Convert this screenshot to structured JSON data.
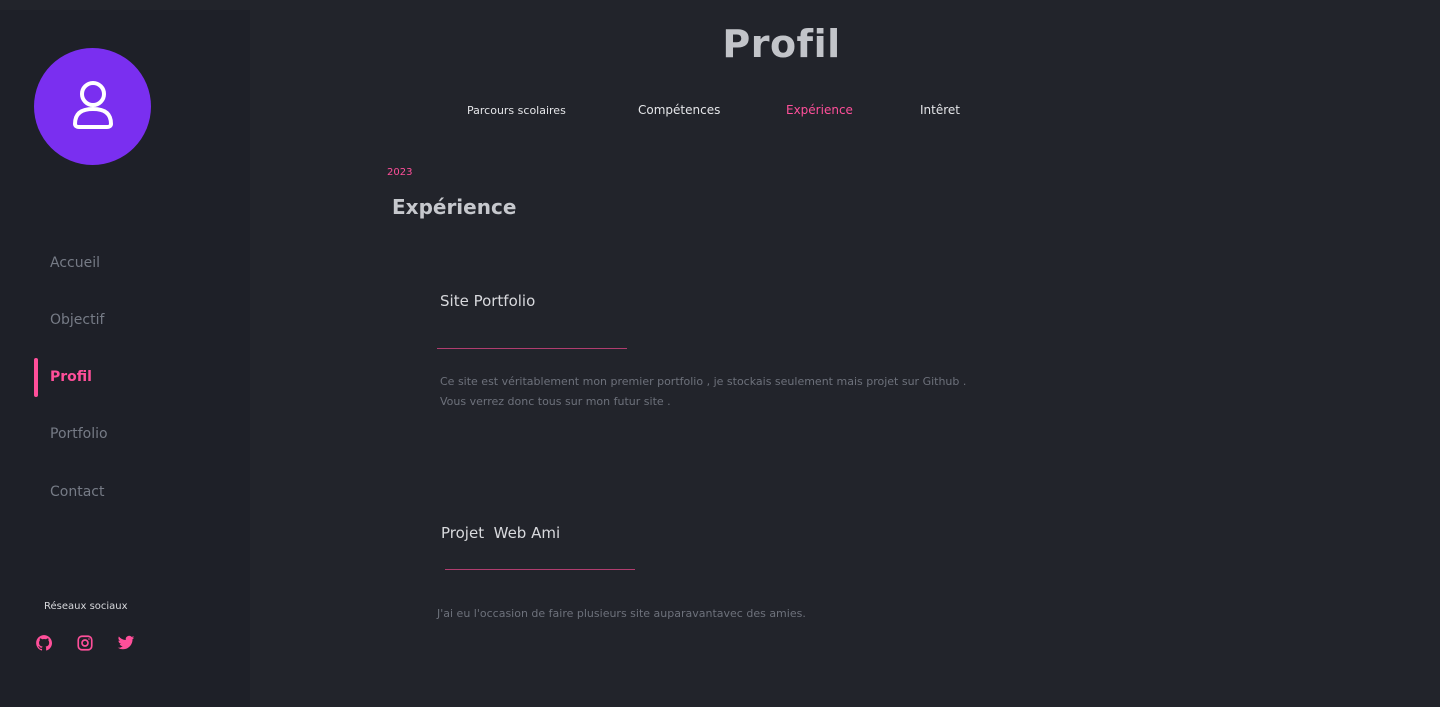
{
  "sidebar": {
    "avatar_icon": "user-icon",
    "nav": [
      {
        "label": "Accueil"
      },
      {
        "label": "Objectif"
      },
      {
        "label": "Profil"
      },
      {
        "label": "Portfolio"
      },
      {
        "label": "Contact"
      }
    ],
    "active_index": 2,
    "socials_title": "Réseaux sociaux",
    "socials": [
      "github-icon",
      "instagram-icon",
      "twitter-icon"
    ]
  },
  "main": {
    "title": "Profil",
    "tabs": [
      {
        "label": "Parcours scolaires"
      },
      {
        "label": "Compétences"
      },
      {
        "label": "Expérience"
      },
      {
        "label": "Intêret"
      }
    ],
    "active_tab": 2,
    "year": "2023",
    "section_title": "Expérience",
    "experiences": [
      {
        "title": "Site Portfolio",
        "desc_line1": "Ce site est véritablement mon premier portfolio , je stockais seulement mais projet sur Github .",
        "desc_line2": "Vous verrez donc tous sur mon futur site ."
      },
      {
        "title": "Projet  Web Ami",
        "desc_line1": "J'ai eu l'occasion de faire plusieurs site auparavantavec des amies."
      }
    ]
  },
  "colors": {
    "background": "#22242b",
    "sidebar": "#1e2028",
    "accent": "#ff4f9a",
    "avatar": "#7a2ff0"
  }
}
